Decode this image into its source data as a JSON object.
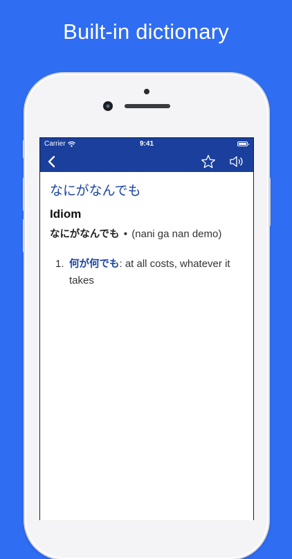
{
  "headline": "Built-in dictionary",
  "status_bar": {
    "carrier": "Carrier",
    "time": "9:41"
  },
  "nav": {
    "back_icon": "chevron-left-icon",
    "favorite_icon": "star-outline-icon",
    "audio_icon": "speaker-icon"
  },
  "entry": {
    "title": "なにがなんでも",
    "part_of_speech": "Idiom",
    "kana": "なにがなんでも",
    "separator": "•",
    "romaji": "(nani ga nan demo)",
    "senses": [
      {
        "number": "1.",
        "term": "何が何でも",
        "definition": ": at all costs, whatever it takes"
      }
    ]
  },
  "colors": {
    "background": "#2f6df2",
    "nav_bar": "#1a3f9c",
    "accent_text": "#1a44a0"
  }
}
